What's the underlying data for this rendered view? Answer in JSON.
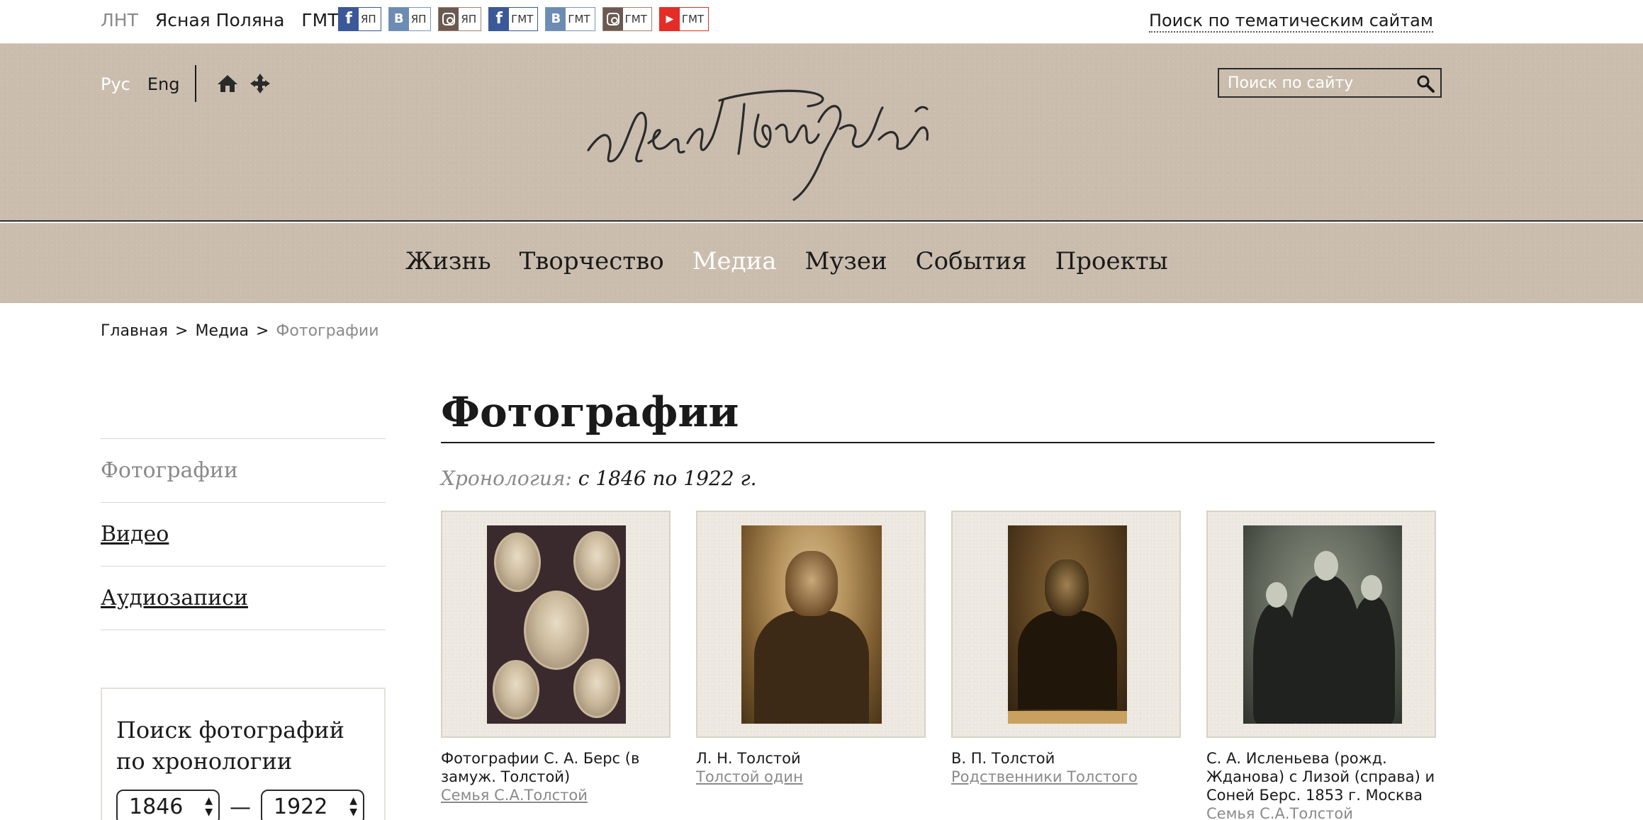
{
  "topbar": {
    "sites": [
      "ЛНТ",
      "Ясная Поляна",
      "ГМТ"
    ],
    "social": [
      {
        "icon": "facebook-icon",
        "label": "ЯП"
      },
      {
        "icon": "vk-icon",
        "label": "ЯП"
      },
      {
        "icon": "instagram-icon",
        "label": "ЯП"
      },
      {
        "icon": "facebook-icon",
        "label": "ГМТ"
      },
      {
        "icon": "vk-icon",
        "label": "ГМТ"
      },
      {
        "icon": "instagram-icon",
        "label": "ГМТ"
      },
      {
        "icon": "youtube-icon",
        "label": "ГМТ"
      }
    ],
    "theme_search": "Поиск по тематическим сайтам"
  },
  "header": {
    "lang_active": "Рус",
    "lang_other": "Eng",
    "search_placeholder": "Поиск по сайту",
    "logo_icon": "tolstoy-signature-icon"
  },
  "nav": {
    "items": [
      "Жизнь",
      "Творчество",
      "Медиа",
      "Музеи",
      "События",
      "Проекты"
    ],
    "current": "Медиа"
  },
  "breadcrumb": {
    "home": "Главная",
    "sep": ">",
    "section": "Медиа",
    "current": "Фотографии"
  },
  "sidebar": {
    "items": [
      "Фотографии",
      "Видео",
      "Аудиозаписи"
    ],
    "chrono_title": "Поиск фотографий по хронологии",
    "year_from": "1846",
    "year_to": "1922",
    "dash": "—"
  },
  "main": {
    "title": "Фотографии",
    "chrono_label": "Хронология:",
    "chrono_value": "с 1846 по 1922 г.",
    "photos": [
      {
        "caption": "Фотографии С. А. Берс (в замуж. Толстой)",
        "category": "Семья С.А.Толстой"
      },
      {
        "caption": "Л. Н. Толстой",
        "category": "Толстой один"
      },
      {
        "caption": "В. П. Толстой",
        "category": "Родственники Толстого"
      },
      {
        "caption": "С. А. Исленьева (рожд. Жданова) с Лизой (справа) и Соней Берс. 1853 г. Москва",
        "category": "Семья С.А.Толстой"
      }
    ]
  }
}
